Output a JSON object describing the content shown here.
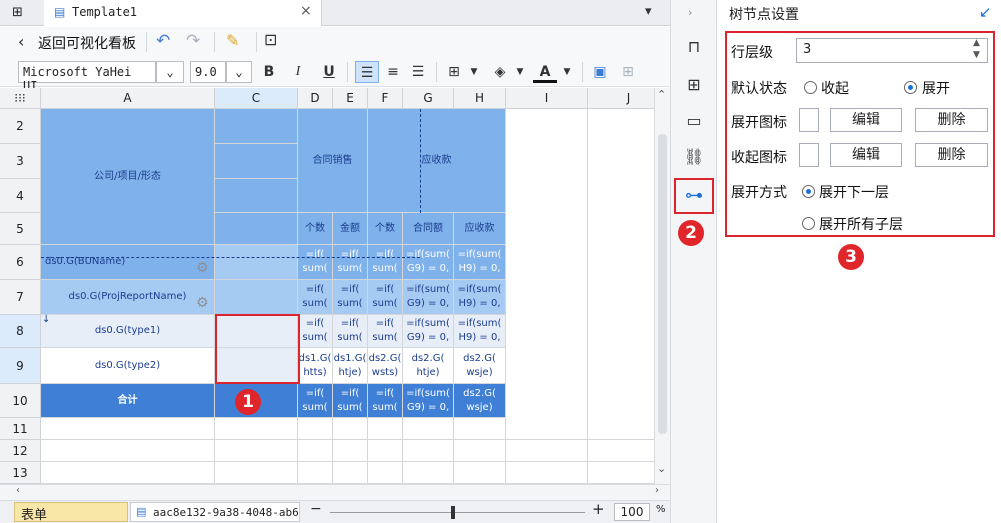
{
  "tab": {
    "title": "Template1"
  },
  "toolbar": {
    "back_label": "返回可视化看板",
    "font_name": "Microsoft YaHei UI",
    "font_size": "9.0",
    "bold": "B",
    "italic": "I",
    "underline": "U",
    "font_color": "A"
  },
  "grid": {
    "columns": [
      "A",
      "C",
      "D",
      "E",
      "F",
      "G",
      "H",
      "I",
      "J"
    ],
    "rows": [
      "2",
      "3",
      "4",
      "5",
      "6",
      "7",
      "8",
      "9",
      "10",
      "11",
      "12",
      "13"
    ],
    "cells": {
      "a2": "公司/项目/形态",
      "d2": "合同销售",
      "f2": "应收款",
      "d5": "个数",
      "e5": "金额",
      "f5": "个数",
      "g5": "合同额",
      "h5": "应收款",
      "a6": "ds0.G(BUName)",
      "a7": "ds0.G(ProjReportName)",
      "a8": "ds0.G(type1)",
      "a9": "ds0.G(type2)",
      "a10": "合计",
      "f_short": "=if(\nsum(",
      "f_long_g": "=if(sum(\nG9) = 0,",
      "f_long_h": "=if(sum(\nH9) = 0,",
      "d9": "ds1.G(\nhtts)",
      "e9": "ds1.G(\nhtje)",
      "f9": "ds2.G(\nwsts)",
      "g9": "ds2.G(\nhtje)",
      "h9": "ds2.G(\nwsje)"
    }
  },
  "statusbar": {
    "sheet_label": "表单",
    "file_label": "aac8e132-9a38-4048-ab6",
    "zoom": "100",
    "percent": "%"
  },
  "panel": {
    "title": "树节点设置",
    "level_label": "行层级",
    "level_value": "3",
    "default_state_label": "默认状态",
    "collapse_option": "收起",
    "expand_option": "展开",
    "expand_icon_label": "展开图标",
    "collapse_icon_label": "收起图标",
    "edit_label": "编辑",
    "delete_label": "删除",
    "expand_mode_label": "展开方式",
    "expand_next": "展开下一层",
    "expand_all": "展开所有子层"
  },
  "badges": [
    "1",
    "2",
    "3"
  ],
  "colors": {
    "accent": "#1a6fd8",
    "highlight_red": "#d9252e",
    "cell_blue": "#7fb1ea"
  }
}
